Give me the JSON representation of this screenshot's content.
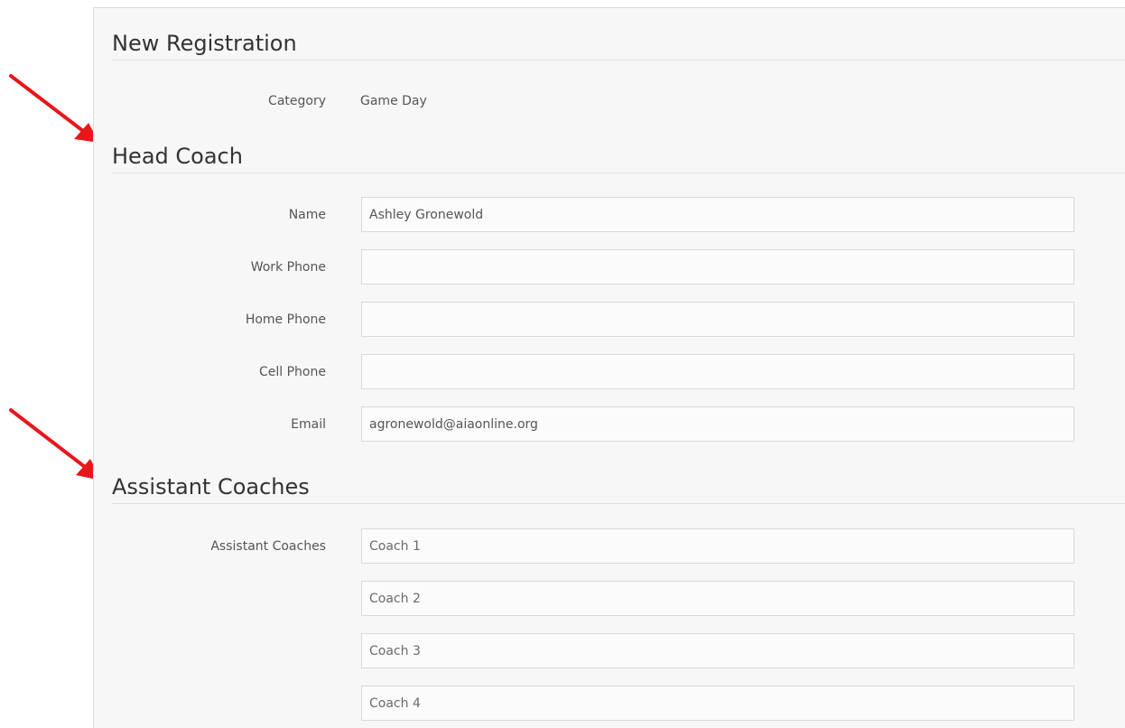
{
  "page": {
    "title": "New Registration"
  },
  "registration": {
    "category_label": "Category",
    "category_value": "Game Day"
  },
  "head_coach": {
    "section_title": "Head Coach",
    "name_label": "Name",
    "name_value": "Ashley Gronewold",
    "work_phone_label": "Work Phone",
    "work_phone_value": "",
    "home_phone_label": "Home Phone",
    "home_phone_value": "",
    "cell_phone_label": "Cell Phone",
    "cell_phone_value": "",
    "email_label": "Email",
    "email_value": "agronewold@aiaonline.org"
  },
  "assistant_coaches": {
    "section_title": "Assistant Coaches",
    "field_label": "Assistant Coaches",
    "placeholders": [
      "Coach 1",
      "Coach 2",
      "Coach 3",
      "Coach 4"
    ]
  },
  "annotations": {
    "arrow_color": "#e8161b"
  }
}
